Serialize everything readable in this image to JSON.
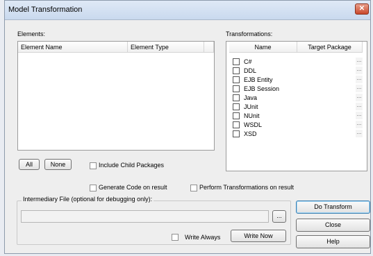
{
  "window": {
    "title": "Model Transformation",
    "close_icon": "close-icon",
    "close_symbol": "✕"
  },
  "elements": {
    "label": "Elements:",
    "columns": [
      "Element Name",
      "Element Type"
    ],
    "all_button": "All",
    "none_button": "None",
    "include_child_label": "Include Child Packages"
  },
  "transformations": {
    "label": "Transformations:",
    "columns": [
      "Name",
      "Target Package"
    ],
    "items": [
      "C#",
      "DDL",
      "EJB Entity",
      "EJB Session",
      "Java",
      "JUnit",
      "NUnit",
      "WSDL",
      "XSD"
    ],
    "dots": "..."
  },
  "options": {
    "generate_code_label": "Generate Code on result",
    "perform_transformations_label": "Perform Transformations on result",
    "intermediary_label": "Intermediary File (optional for debugging only):",
    "intermediary_value": "",
    "browse_button": "...",
    "write_always_label": "Write Always",
    "write_now_button": "Write Now"
  },
  "actions": {
    "do_transform": "Do Transform",
    "close": "Close",
    "help": "Help"
  }
}
